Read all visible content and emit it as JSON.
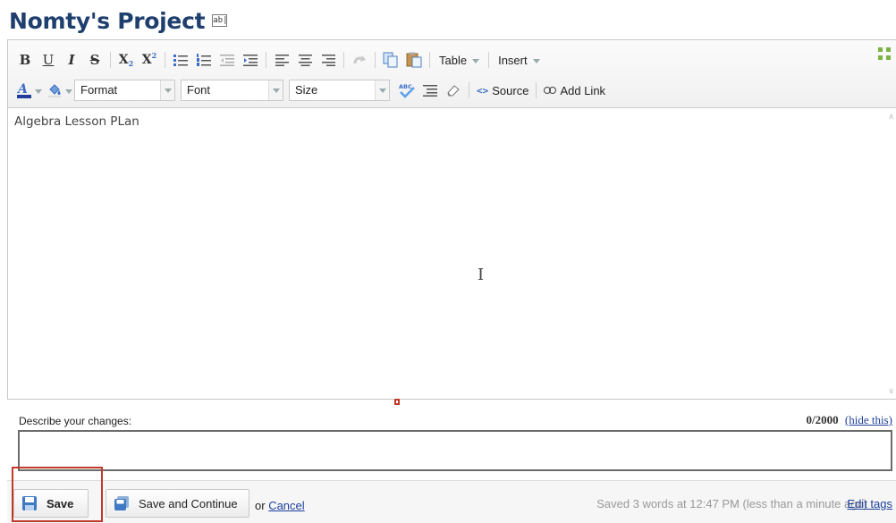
{
  "page": {
    "title": "Nomty's Project",
    "rename_icon_text": "ab|"
  },
  "toolbar": {
    "row1_buttons": [
      {
        "name": "bold-button",
        "icon": "bold-icon",
        "label": "B"
      },
      {
        "name": "underline-button",
        "icon": "underline-icon",
        "label": "U"
      },
      {
        "name": "italic-button",
        "icon": "italic-icon",
        "label": "I"
      },
      {
        "name": "strikethrough-button",
        "icon": "strikethrough-icon",
        "label": "S"
      },
      {
        "name": "subscript-button",
        "icon": "subscript-icon",
        "label": "X"
      },
      {
        "name": "superscript-button",
        "icon": "superscript-icon",
        "label": "X"
      }
    ],
    "table_label": "Table",
    "insert_label": "Insert",
    "format_label": "Format",
    "font_label": "Font",
    "size_label": "Size",
    "source_label": "Source",
    "add_link_label": "Add Link",
    "accent_color": "#3a6cc8",
    "source_icon_text": "<>"
  },
  "editor": {
    "content": "Algebra Lesson PLan"
  },
  "changes": {
    "label": "Describe your changes:",
    "count": "0/2000",
    "hide_label": "(hide this)",
    "value": ""
  },
  "footer": {
    "save_label": "Save",
    "save_continue_label": "Save and Continue",
    "or_text": "or",
    "cancel_label": "Cancel",
    "status": "Saved 3 words at 12:47 PM (less than a minute ago)",
    "edit_tags_label": "Edit tags"
  }
}
